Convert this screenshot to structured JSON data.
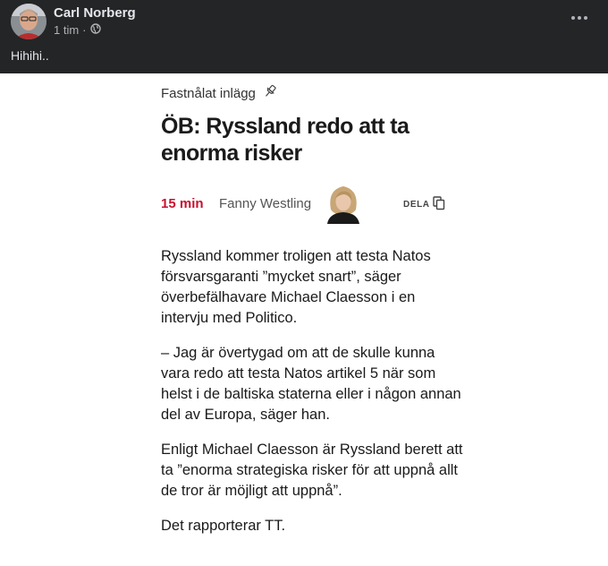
{
  "post": {
    "author": "Carl Norberg",
    "time": "1 tim",
    "separator": "·",
    "text": "Hihihi.."
  },
  "article": {
    "pinned_label": "Fastnålat inlägg",
    "headline": "ÖB: Ryssland redo att ta enorma risker",
    "read_time": "15 min",
    "byline": "Fanny Westling",
    "share_label": "DELA",
    "paragraphs": [
      "Ryssland kommer troligen att testa Natos försvarsgaranti ”mycket snart”, säger överbefälhavare Michael Claesson i en intervju med Politico.",
      "– Jag är övertygad om att de skulle kunna vara redo att testa Natos artikel 5 när som helst i de baltiska staterna eller i någon annan del av Europa, säger han.",
      "Enligt Michael Claesson är Ryssland berett att ta ”enorma strategiska risker för att uppnå allt de tror är möjligt att uppnå”.",
      "Det rapporterar TT."
    ]
  },
  "colors": {
    "header_bg": "#242526",
    "read_time": "#c8102e"
  },
  "icons": [
    "avatar-photo",
    "globe-icon",
    "more-options-icon",
    "pin-icon",
    "author-photo",
    "copy-icon"
  ]
}
